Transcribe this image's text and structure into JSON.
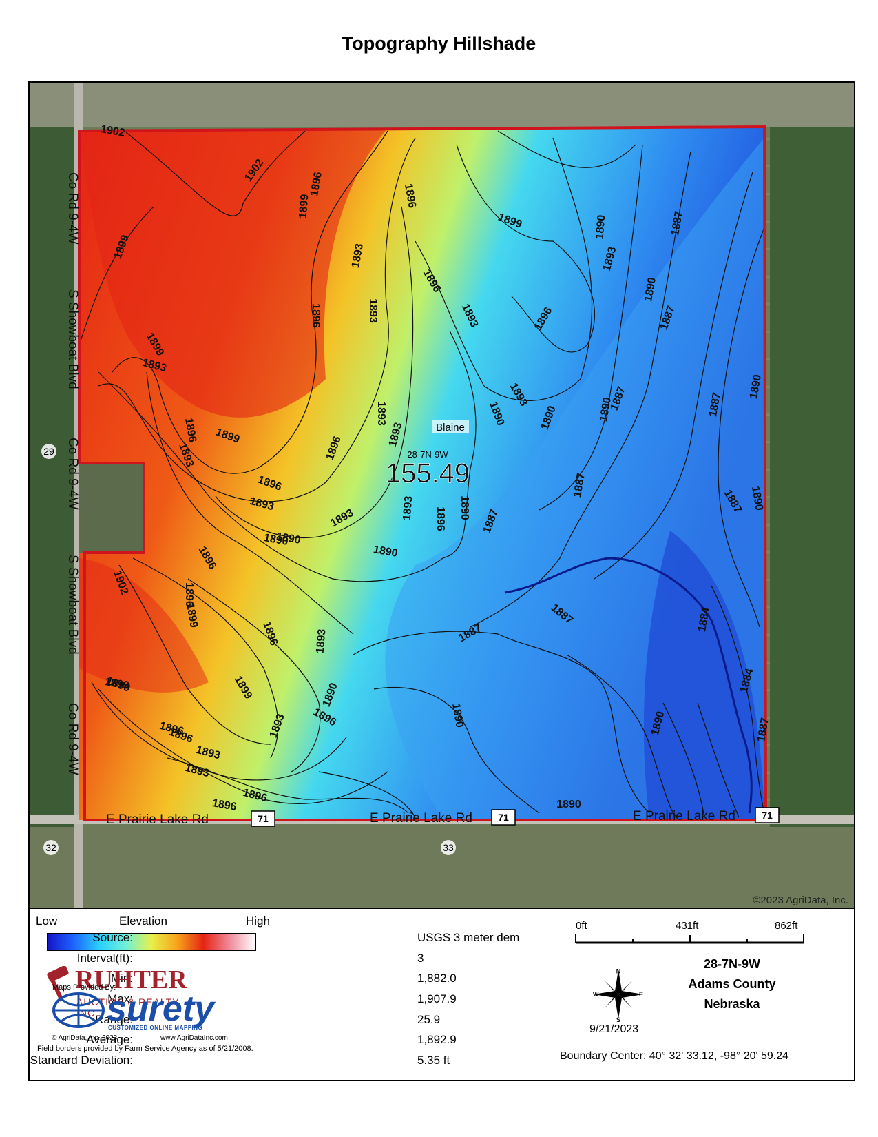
{
  "title": "Topography Hillshade",
  "map": {
    "acres": "155.49",
    "section_label": "28-7N-9W",
    "township_label": "Blaine",
    "copyright": "©2023 AgriData, Inc.",
    "section_numbers": [
      "29",
      "32",
      "33"
    ],
    "road_labels": [
      "Co Rd 9-4W",
      "S Showboat Blvd",
      "Co Rd 9-4W",
      "S Showboat Blvd",
      "Co Rd 9-4W",
      "E Prairie Lake Rd",
      "E Prairie Lake Rd",
      "E Prairie Lake Rd"
    ],
    "highway_shield": "71",
    "contour_labels": [
      "1902",
      "1902",
      "1899",
      "1896",
      "1896",
      "1899",
      "1893",
      "1890",
      "1893",
      "1887",
      "1890",
      "1899",
      "1896",
      "1893",
      "1896",
      "1893",
      "1890",
      "1896",
      "1899",
      "1893",
      "1896",
      "1899",
      "1896",
      "1896",
      "1893",
      "1893",
      "1893",
      "1887",
      "1890",
      "1893",
      "1890",
      "1887",
      "1887",
      "1887",
      "1890",
      "1887",
      "1893",
      "1893",
      "1896",
      "1890",
      "1890",
      "1890",
      "1887",
      "1887",
      "1884",
      "1887",
      "1884",
      "1887",
      "1890",
      "1896",
      "1893",
      "1896",
      "1890",
      "1893",
      "1899",
      "1896",
      "1899",
      "1902",
      "1896",
      "1893",
      "1890",
      "1896",
      "1890",
      "1893",
      "1896",
      "1899",
      "1899",
      "1896",
      "1893",
      "1896",
      "1890",
      "1890"
    ],
    "colors": {
      "boundary": "#d0141e",
      "low": "#1414c8",
      "high": "#ffffff"
    }
  },
  "legend": {
    "low": "Low",
    "elevation": "Elevation",
    "high": "High"
  },
  "stats": [
    {
      "label": "Source:",
      "value": "USGS 3 meter dem"
    },
    {
      "label": "Interval(ft):",
      "value": "3"
    },
    {
      "label": "Min:",
      "value": "1,882.0"
    },
    {
      "label": "Max:",
      "value": "1,907.9"
    },
    {
      "label": "Range:",
      "value": "25.9"
    },
    {
      "label": "Average:",
      "value": "1,892.9"
    },
    {
      "label": "Standard Deviation:",
      "value": "5.35 ft"
    }
  ],
  "brand": {
    "ruhter_name": "RUHTER",
    "ruhter_sub": "AUCTION & REALTY, INC.",
    "provided": "Maps Provided By:",
    "surety": "surety",
    "surety_tag": "CUSTOMIZED ONLINE MAPPING",
    "copyright": "© AgriData, Inc. 2023",
    "website": "www.AgriDataInc.com",
    "fsa": "Field borders provided by Farm Service Agency as of 5/21/2008."
  },
  "scale": {
    "labels": [
      "0ft",
      "431ft",
      "862ft"
    ]
  },
  "north_arrow": {
    "n": "N",
    "s": "S",
    "e": "E",
    "w": "W"
  },
  "date": "9/21/2023",
  "location": {
    "line1": "28-7N-9W",
    "line2": "Adams County",
    "line3": "Nebraska"
  },
  "boundary_center": "Boundary Center: 40° 32' 33.12, -98° 20' 59.24"
}
